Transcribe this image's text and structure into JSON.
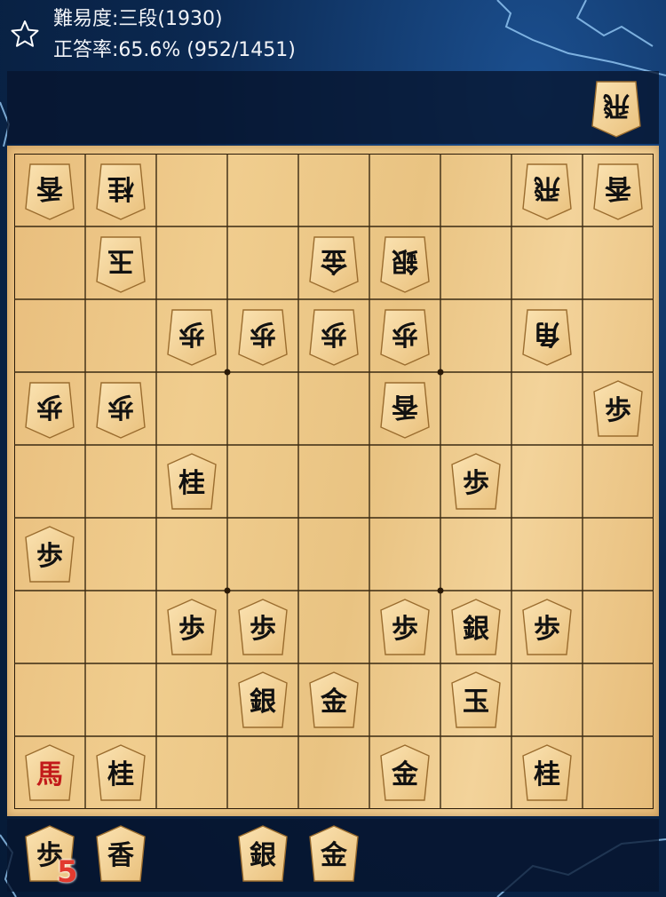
{
  "header": {
    "difficulty_text": "難易度:三段(1930)",
    "accuracy_text": "正答率:65.6% (952/1451)"
  },
  "colors": {
    "accent_red": "#e23b2f",
    "board_wood": "#eecb8c",
    "background_blue": "#0b2850"
  },
  "icons": {
    "favorite": "star-outline-icon"
  },
  "gote_hand": [
    {
      "glyph": "飛",
      "label": "rook"
    }
  ],
  "sente_hand": {
    "pieces": [
      {
        "glyph": "歩",
        "label": "pawn",
        "slot": 0
      },
      {
        "glyph": "香",
        "label": "lance",
        "slot": 1
      },
      {
        "glyph": "銀",
        "label": "silver",
        "slot": 3
      },
      {
        "glyph": "金",
        "label": "gold",
        "slot": 4
      }
    ],
    "pawn_count": "5"
  },
  "board": {
    "files": 9,
    "ranks": 9,
    "pieces": [
      {
        "file": 9,
        "rank": 1,
        "glyph": "香",
        "label": "lance",
        "owner": "gote"
      },
      {
        "file": 8,
        "rank": 1,
        "glyph": "桂",
        "label": "knight",
        "owner": "gote"
      },
      {
        "file": 2,
        "rank": 1,
        "glyph": "飛",
        "label": "rook",
        "owner": "gote"
      },
      {
        "file": 1,
        "rank": 1,
        "glyph": "香",
        "label": "lance",
        "owner": "gote"
      },
      {
        "file": 8,
        "rank": 2,
        "glyph": "玉",
        "label": "king",
        "owner": "gote"
      },
      {
        "file": 5,
        "rank": 2,
        "glyph": "金",
        "label": "gold",
        "owner": "gote"
      },
      {
        "file": 4,
        "rank": 2,
        "glyph": "銀",
        "label": "silver",
        "owner": "gote"
      },
      {
        "file": 7,
        "rank": 3,
        "glyph": "歩",
        "label": "pawn",
        "owner": "gote"
      },
      {
        "file": 6,
        "rank": 3,
        "glyph": "歩",
        "label": "pawn",
        "owner": "gote"
      },
      {
        "file": 5,
        "rank": 3,
        "glyph": "歩",
        "label": "pawn",
        "owner": "gote"
      },
      {
        "file": 4,
        "rank": 3,
        "glyph": "歩",
        "label": "pawn",
        "owner": "gote"
      },
      {
        "file": 2,
        "rank": 3,
        "glyph": "角",
        "label": "bishop",
        "owner": "gote"
      },
      {
        "file": 9,
        "rank": 4,
        "glyph": "歩",
        "label": "pawn",
        "owner": "gote"
      },
      {
        "file": 8,
        "rank": 4,
        "glyph": "歩",
        "label": "pawn",
        "owner": "gote"
      },
      {
        "file": 4,
        "rank": 4,
        "glyph": "香",
        "label": "lance",
        "owner": "gote"
      },
      {
        "file": 1,
        "rank": 4,
        "glyph": "歩",
        "label": "pawn",
        "owner": "sente"
      },
      {
        "file": 7,
        "rank": 5,
        "glyph": "桂",
        "label": "knight",
        "owner": "sente"
      },
      {
        "file": 3,
        "rank": 5,
        "glyph": "歩",
        "label": "pawn",
        "owner": "sente"
      },
      {
        "file": 9,
        "rank": 6,
        "glyph": "歩",
        "label": "pawn",
        "owner": "sente"
      },
      {
        "file": 7,
        "rank": 7,
        "glyph": "歩",
        "label": "pawn",
        "owner": "sente"
      },
      {
        "file": 6,
        "rank": 7,
        "glyph": "歩",
        "label": "pawn",
        "owner": "sente"
      },
      {
        "file": 4,
        "rank": 7,
        "glyph": "歩",
        "label": "pawn",
        "owner": "sente"
      },
      {
        "file": 3,
        "rank": 7,
        "glyph": "銀",
        "label": "silver",
        "owner": "sente"
      },
      {
        "file": 2,
        "rank": 7,
        "glyph": "歩",
        "label": "pawn",
        "owner": "sente"
      },
      {
        "file": 6,
        "rank": 8,
        "glyph": "銀",
        "label": "silver",
        "owner": "sente"
      },
      {
        "file": 5,
        "rank": 8,
        "glyph": "金",
        "label": "gold",
        "owner": "sente"
      },
      {
        "file": 3,
        "rank": 8,
        "glyph": "玉",
        "label": "king",
        "owner": "sente"
      },
      {
        "file": 9,
        "rank": 9,
        "glyph": "馬",
        "label": "horse",
        "owner": "sente",
        "promoted": true
      },
      {
        "file": 8,
        "rank": 9,
        "glyph": "桂",
        "label": "knight",
        "owner": "sente"
      },
      {
        "file": 4,
        "rank": 9,
        "glyph": "金",
        "label": "gold",
        "owner": "sente"
      },
      {
        "file": 2,
        "rank": 9,
        "glyph": "桂",
        "label": "knight",
        "owner": "sente"
      }
    ]
  }
}
